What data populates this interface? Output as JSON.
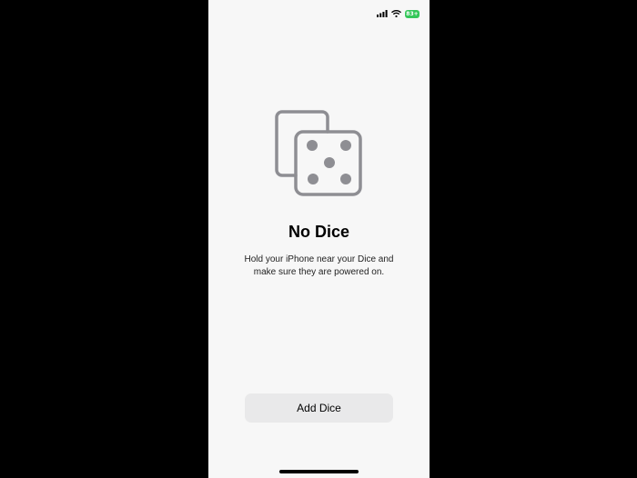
{
  "status_bar": {
    "battery_level": "83+",
    "battery_color": "#34c759",
    "icons": [
      "cellular-signal-icon",
      "wifi-icon",
      "battery-icon"
    ]
  },
  "empty_state": {
    "icon": "dice-icon",
    "icon_color": "#8e8e93",
    "title": "No Dice",
    "message": "Hold your iPhone near your Dice and make sure they are powered on."
  },
  "actions": {
    "add_button_label": "Add Dice"
  }
}
